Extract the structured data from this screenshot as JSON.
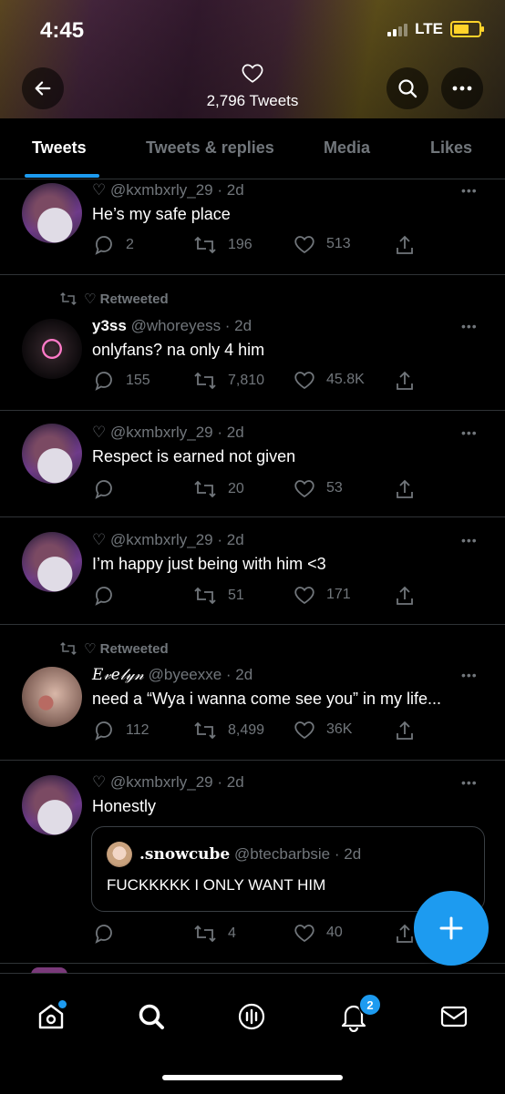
{
  "status": {
    "time": "4:45",
    "network": "LTE"
  },
  "header": {
    "tweet_count": "2,796 Tweets"
  },
  "tabs": [
    "Tweets",
    "Tweets & replies",
    "Media",
    "Likes"
  ],
  "tweets": [
    {
      "handle": "♡ @kxmbxrly_29 · 2d",
      "text": "He’s my safe place",
      "replies": "2",
      "retweets": "196",
      "likes": "513"
    },
    {
      "retweeted_label": "♡ Retweeted",
      "name": "y3ss",
      "handle": "@whoreyess · 2d",
      "text": "onlyfans? na only 4 him",
      "replies": "155",
      "retweets": "7,810",
      "likes": "45.8K"
    },
    {
      "handle": "♡ @kxmbxrly_29 · 2d",
      "text": "Respect is earned not given",
      "retweets": "20",
      "likes": "53"
    },
    {
      "handle": "♡ @kxmbxrly_29 · 2d",
      "text": "I’m happy just being with him <3",
      "retweets": "51",
      "likes": "171"
    },
    {
      "retweeted_label": "♡ Retweeted",
      "name": "𝐸𝓋𝑒𝓁𝓎𝓃",
      "handle": "@byeexxe · 2d",
      "text": "need a “Wya i wanna come see you” in my life...",
      "replies": "112",
      "retweets": "8,499",
      "likes": "36K"
    },
    {
      "handle": "♡ @kxmbxrly_29 · 2d",
      "text": "Honestly",
      "quote_name": ".snowcube",
      "quote_handle": "@btecbarbsie · 2d",
      "quote_text": "FUCKKKKK I ONLY WANT HIM",
      "retweets": "4",
      "likes": "40"
    }
  ],
  "nav": {
    "notifications_badge": "2"
  },
  "colors": {
    "accent": "#1d9bf0",
    "muted": "#71767b",
    "background": "#000000"
  }
}
